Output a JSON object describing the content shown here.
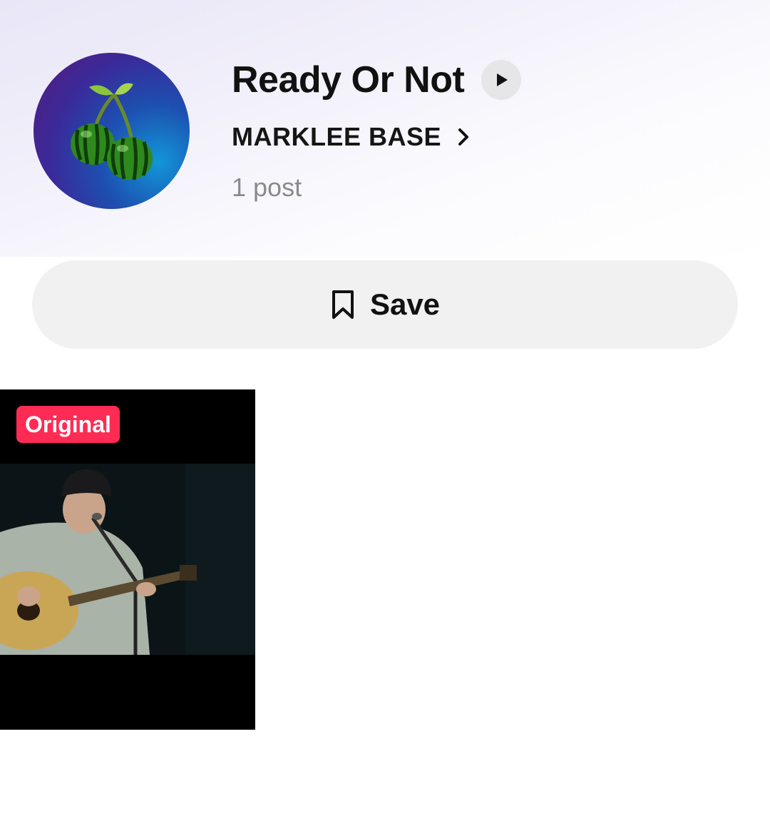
{
  "sound": {
    "title": "Ready Or Not",
    "artist": "MARKLEE BASE",
    "post_count": "1 post"
  },
  "actions": {
    "save_label": "Save"
  },
  "posts": [
    {
      "badge": "Original"
    }
  ],
  "colors": {
    "badge": "#fe2c55",
    "save_button_bg": "#f1f1f2",
    "muted_text": "#8a8a8e"
  },
  "icons": {
    "play": "play-icon",
    "chevron": "chevron-right-icon",
    "bookmark": "bookmark-icon"
  }
}
